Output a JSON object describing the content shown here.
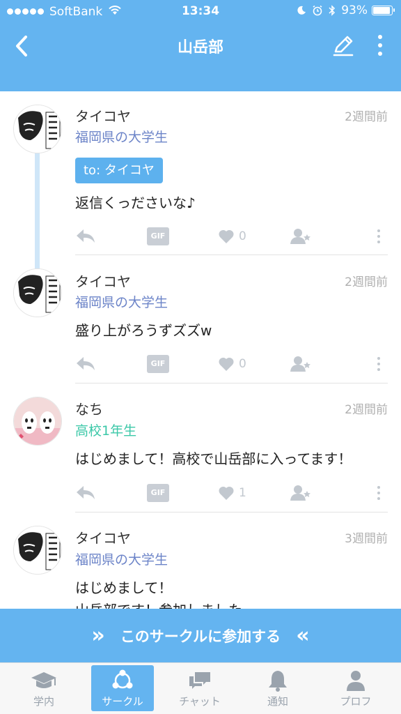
{
  "status_bar": {
    "carrier": "SoftBank",
    "time": "13:34",
    "battery": "93%",
    "battery_level": 0.93
  },
  "nav": {
    "title": "山岳部"
  },
  "posts": [
    {
      "name": "タイコヤ",
      "time": "2週間前",
      "meta": "福岡県の大学生",
      "to": "to: タイコヤ",
      "body": "返信くっださいな♪",
      "likes": "0"
    },
    {
      "name": "タイコヤ",
      "time": "2週間前",
      "meta": "福岡県の大学生",
      "body": "盛り上がろうずズズw",
      "likes": "0"
    },
    {
      "name": "なち",
      "time": "2週間前",
      "meta": "高校1年生",
      "body": "はじめまして！高校で山岳部に入ってます！",
      "likes": "1"
    },
    {
      "name": "タイコヤ",
      "time": "3週間前",
      "meta": "福岡県の大学生",
      "body": "はじめまして！\n山岳部です！参加しました"
    }
  ],
  "actions": {
    "gif_label": "GIF"
  },
  "join_banner": {
    "label": "このサークルに参加する",
    "left_chevron": "»",
    "right_chevron": "«"
  },
  "tabs": [
    {
      "label": "学内",
      "icon": "graduation-cap-icon",
      "active": false
    },
    {
      "label": "サークル",
      "icon": "circle-nodes-icon",
      "active": true
    },
    {
      "label": "チャット",
      "icon": "chat-bubbles-icon",
      "active": false
    },
    {
      "label": "通知",
      "icon": "bell-icon",
      "active": false
    },
    {
      "label": "プロフ",
      "icon": "person-icon",
      "active": false
    }
  ],
  "colors": {
    "primary": "#64b4f0",
    "badge": "#5db1ee",
    "meta_blue": "#6c84c8",
    "meta_green": "#3cc8a8",
    "action_gray": "#c2c8cf"
  }
}
